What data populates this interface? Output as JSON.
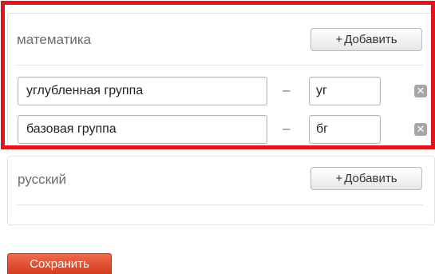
{
  "subjects": [
    {
      "title": "математика",
      "add_label": "Добавить",
      "add_icon": "plus-icon",
      "groups": [
        {
          "name": "углубленная группа",
          "separator": "–",
          "abbr": "уг",
          "remove_icon": "close-icon"
        },
        {
          "name": "базовая группа",
          "separator": "–",
          "abbr": "бг",
          "remove_icon": "close-icon"
        }
      ]
    },
    {
      "title": "русский",
      "add_label": "Добавить",
      "add_icon": "plus-icon",
      "groups": []
    }
  ],
  "save_label": "Сохранить",
  "colors": {
    "highlight": "#e3151c",
    "save_button": "#e04e2f"
  }
}
